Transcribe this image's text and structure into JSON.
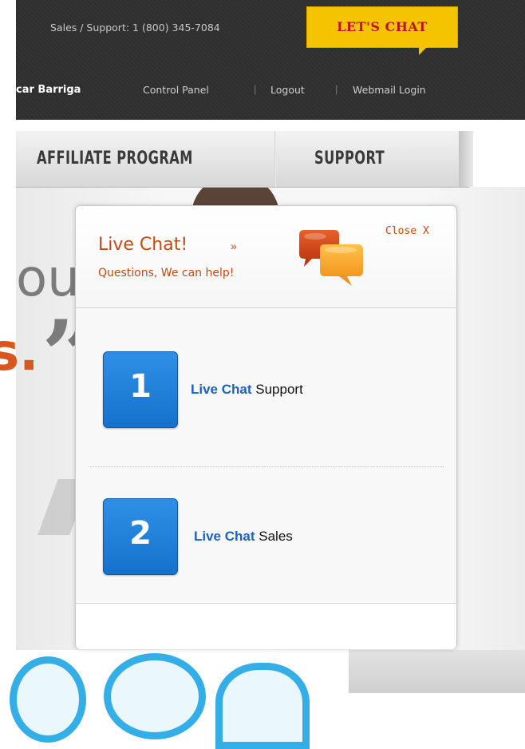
{
  "header": {
    "phone_text": "Sales / Support: 1 (800) 345-7084",
    "chat_button_label": "LET'S CHAT",
    "user_name": "car Barriga",
    "links": [
      "Control Panel",
      "Logout",
      "Webmail Login"
    ]
  },
  "nav": {
    "tabs": [
      "AFFILIATE PROGRAM",
      "SUPPORT"
    ]
  },
  "hero": {
    "fragment_1": "ou",
    "fragment_2": "s.",
    "quote_mark": "”"
  },
  "popup": {
    "title": "Live Chat!",
    "title_arrow": "»",
    "subtitle": "Questions, We can help!",
    "close_label": "Close X",
    "options": [
      {
        "number": "1",
        "highlight": "Live Chat",
        "label": "Support"
      },
      {
        "number": "2",
        "highlight": "Live Chat",
        "label": "Sales"
      }
    ]
  },
  "colors": {
    "accent_orange": "#c74a12",
    "button_yellow": "#f5c400",
    "button_text_red": "#c0121a",
    "option_blue": "#1572cc",
    "link_blue": "#1a62c2"
  },
  "icons": {
    "chat_bubbles": "chat-bubbles-icon"
  }
}
